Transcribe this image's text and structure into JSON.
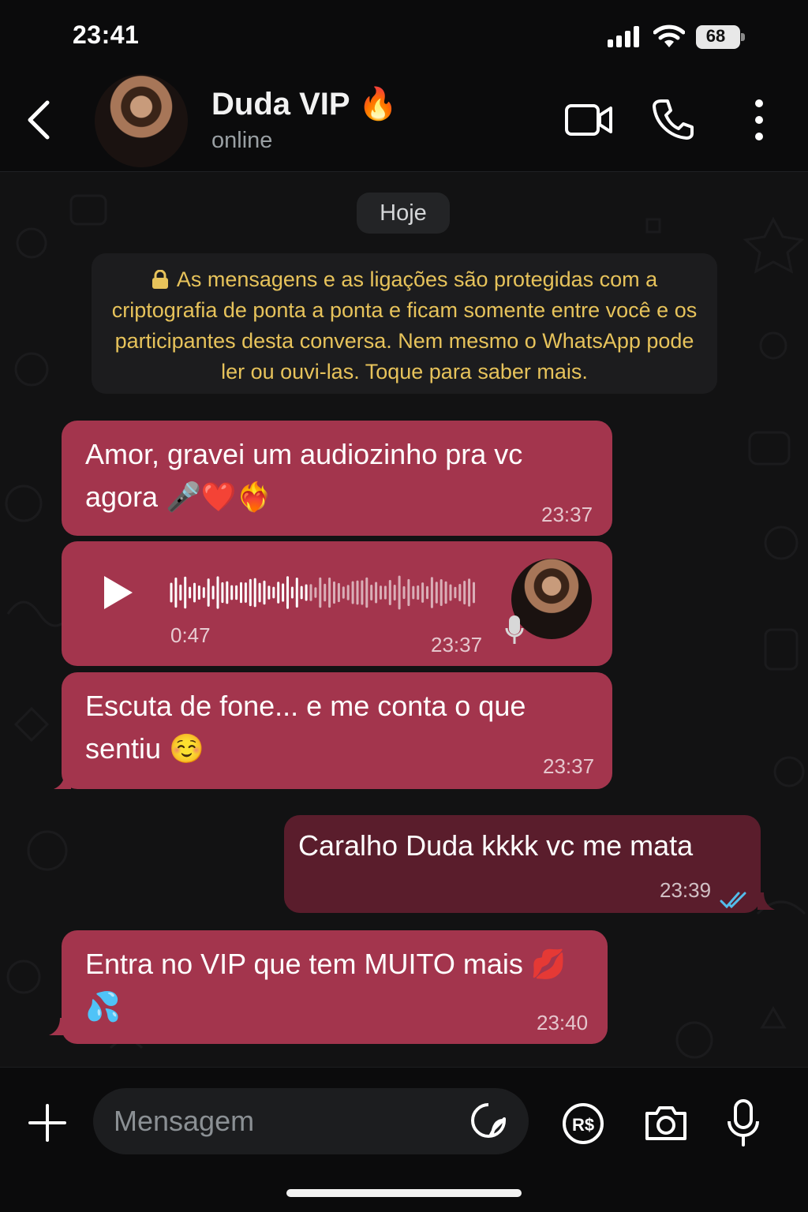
{
  "status_bar": {
    "time": "23:41",
    "battery": "68",
    "icons": [
      "signal-icon",
      "wifi-icon",
      "battery-icon"
    ]
  },
  "header": {
    "contact_name": "Duda VIP 🔥",
    "presence": "online",
    "icons": [
      "back-chevron-icon",
      "avatar",
      "video-call-icon",
      "phone-call-icon",
      "more-vertical-icon"
    ]
  },
  "chat": {
    "date_separator": "Hoje",
    "encryption_notice": "As mensagens e as ligações são protegidas com a criptografia de ponta a ponta e ficam somente entre você e os participantes desta conversa. Nem mesmo o WhatsApp pode ler ou ouvi-las. Toque para saber mais.",
    "messages": [
      {
        "direction": "incoming",
        "type": "text",
        "text": "Amor, gravei um audiozinho pra vc agora 🎤❤️❤️‍🔥",
        "time": "23:37"
      },
      {
        "direction": "incoming",
        "type": "voice",
        "duration": "0:47",
        "time": "23:37",
        "played": false
      },
      {
        "direction": "incoming",
        "type": "text",
        "text": "Escuta de fone... e me conta o que sentiu ☺️",
        "time": "23:37"
      },
      {
        "direction": "outgoing",
        "type": "text",
        "text": "Caralho Duda kkkk vc me mata",
        "time": "23:39",
        "status": "read"
      },
      {
        "direction": "incoming",
        "type": "text",
        "text": "Entra no VIP que tem MUITO mais 💋💦",
        "time": "23:40"
      }
    ]
  },
  "composer": {
    "placeholder": "Mensagem",
    "icons": [
      "plus-icon",
      "sticker-icon",
      "pix-payment-icon",
      "camera-icon",
      "microphone-icon"
    ]
  },
  "colors": {
    "incoming_bubble": "#a3354d",
    "outgoing_bubble": "#5a1d2c",
    "read_ticks": "#53bdeb",
    "encryption_text": "#e7c35b"
  }
}
